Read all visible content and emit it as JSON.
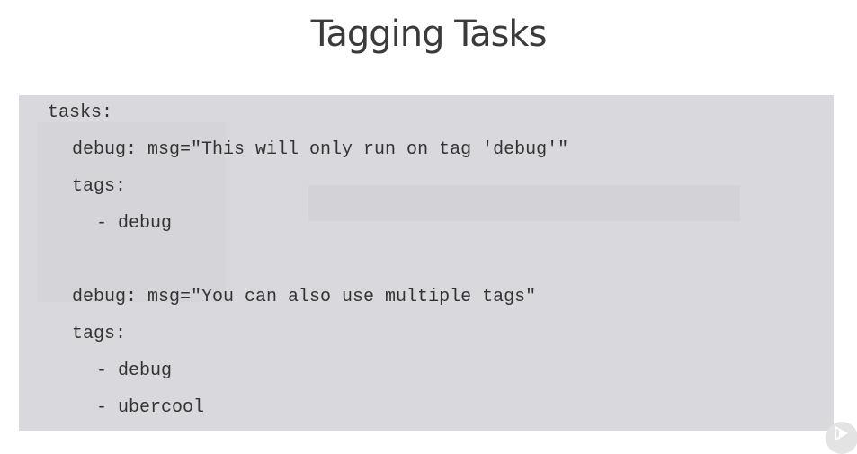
{
  "slide": {
    "title": "Tagging Tasks"
  },
  "code_block": {
    "lines": [
      "tasks:",
      "debug: msg=\"This will only run on tag 'debug'\"",
      "tags:",
      "- debug",
      "debug: msg=\"You can also use multiple tags\"",
      "tags:",
      "- debug",
      "- ubercool"
    ]
  },
  "overlay": {
    "icon": "play-logo-icon"
  },
  "colors": {
    "title": "#3a3a3a",
    "panel_background": "#d9d8dc",
    "code_text": "#333333"
  }
}
